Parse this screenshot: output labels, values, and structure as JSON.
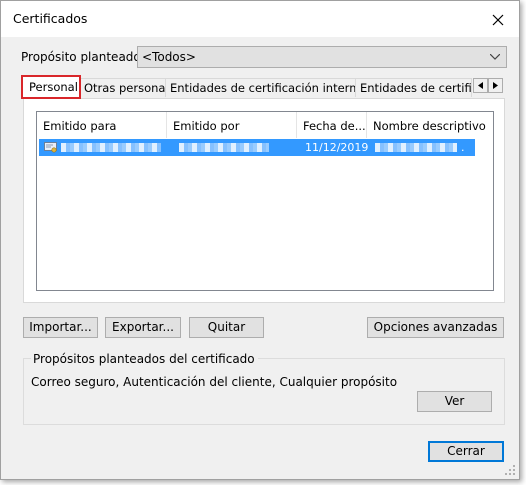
{
  "window": {
    "title": "Certificados"
  },
  "purpose": {
    "label": "Propósito planteado:",
    "selected": "<Todos>"
  },
  "tabs": [
    "Personal",
    "Otras personas",
    "Entidades de certificación intermedias",
    "Entidades de certificaci"
  ],
  "table": {
    "columns": [
      "Emitido para",
      "Emitido por",
      "Fecha de...",
      "Nombre descriptivo"
    ],
    "rows": [
      {
        "issued_to": "",
        "issued_by": "",
        "date": "11/12/2019",
        "friendly_name": "."
      }
    ]
  },
  "buttons": {
    "import": "Importar...",
    "export": "Exportar...",
    "remove": "Quitar",
    "advanced": "Opciones avanzadas",
    "view": "Ver",
    "close": "Cerrar"
  },
  "purposes_group": {
    "title": "Propósitos planteados del certificado",
    "text": "Correo seguro, Autenticación del cliente, Cualquier propósito"
  },
  "colors": {
    "selection": "#3399ff",
    "highlight_tab": "#d9262a",
    "default_button": "#0078d7"
  },
  "icons": [
    "close-icon",
    "chevron-down-icon",
    "tab-scroll-left-icon",
    "tab-scroll-right-icon",
    "certificate-icon",
    "resize-grip-icon"
  ]
}
